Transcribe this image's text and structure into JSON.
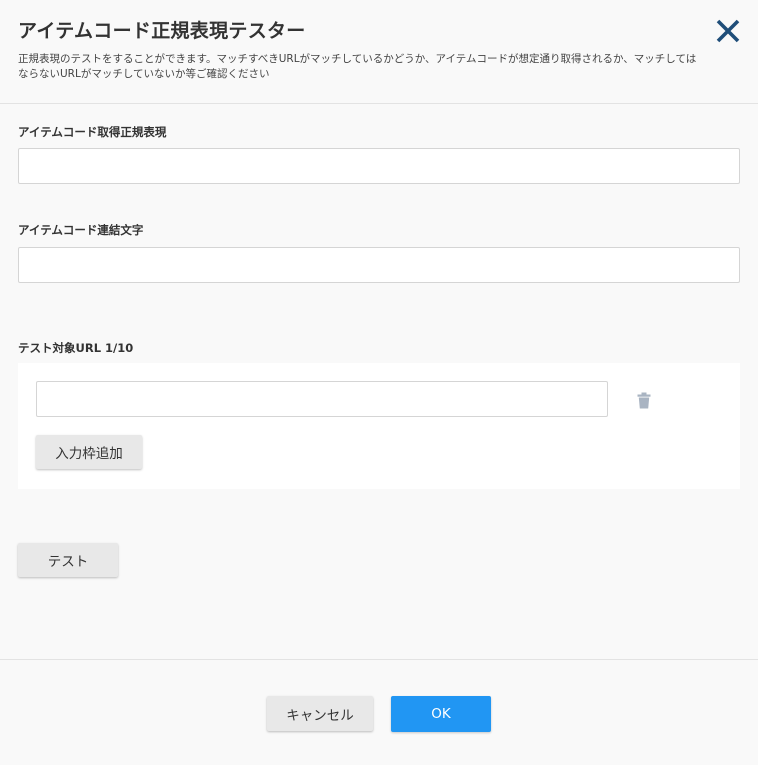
{
  "dialog": {
    "title": "アイテムコード正規表現テスター",
    "description": "正規表現のテストをすることができます。マッチすべきURLがマッチしているかどうか、アイテムコードが想定通り取得されるか、マッチしてはならないURLがマッチしていないか等ご確認ください",
    "close_icon": "close-icon"
  },
  "regex_field": {
    "label": "アイテムコード取得正規表現",
    "value": "",
    "placeholder": ""
  },
  "joiner_field": {
    "label": "アイテムコード連結文字",
    "value": "",
    "placeholder": ""
  },
  "url_section": {
    "label": "テスト対象URL 1/10",
    "urls": [
      ""
    ],
    "delete_icon": "trash-icon",
    "add_label": "入力枠追加"
  },
  "test_button": {
    "label": "テスト"
  },
  "footer": {
    "cancel_label": "キャンセル",
    "ok_label": "OK"
  },
  "colors": {
    "accent": "#2196f3",
    "close_icon": "#1f4e79",
    "trash_icon": "#a9b4c2"
  }
}
